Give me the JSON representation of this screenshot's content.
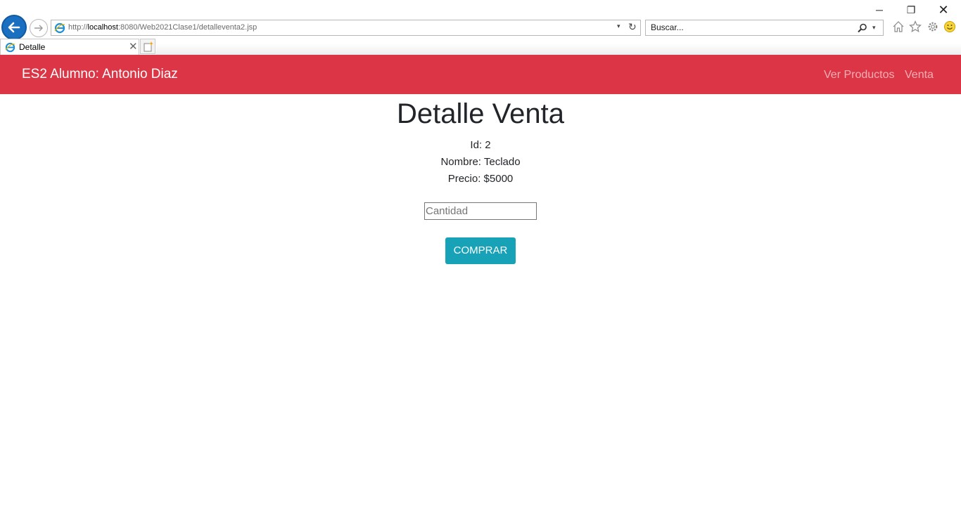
{
  "browser": {
    "url_scheme": "http://",
    "url_host": "localhost",
    "url_rest": ":8080/Web2021Clase1/detalleventa2.jsp",
    "search_placeholder": "Buscar...",
    "tab_title": "Detalle",
    "window_buttons": {
      "minimize": "─",
      "restore": "❐",
      "close": "✕"
    },
    "dropdown_glyph": "▾",
    "refresh_glyph": "↻",
    "tab_close_glyph": "✕"
  },
  "navbar": {
    "brand": "ES2 Alumno: Antonio Diaz",
    "links": [
      "Ver Productos",
      "Venta"
    ],
    "background_color": "#dc3545"
  },
  "main": {
    "title": "Detalle Venta",
    "id_line": "Id: 2",
    "name_line": "Nombre: Teclado",
    "price_line": "Precio: $5000",
    "quantity_placeholder": "Cantidad",
    "buy_label": "COMPRAR",
    "buy_color": "#17a2b8"
  }
}
